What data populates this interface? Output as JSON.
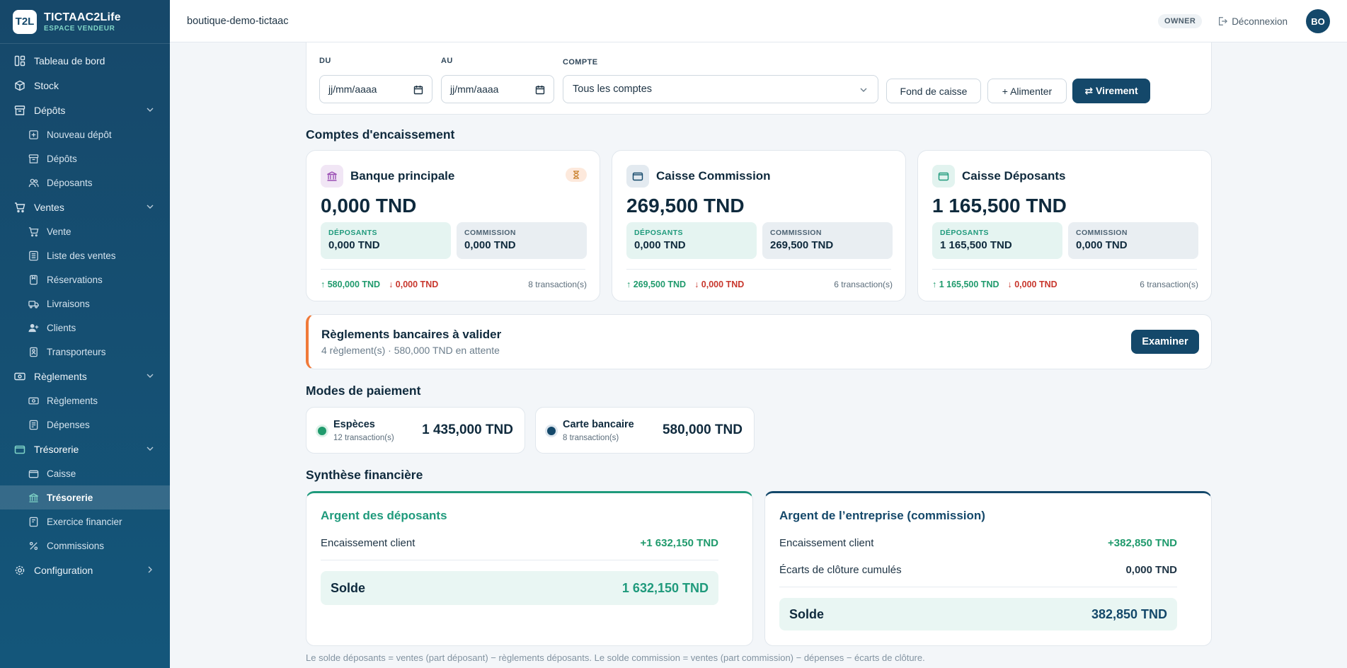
{
  "brand": {
    "logo": "T2L",
    "name": "TICTAAC2Life",
    "subtitle": "ESPACE VENDEUR"
  },
  "sidebar": {
    "items": [
      {
        "label": "Tableau de bord",
        "icon": "dashboard-icon"
      },
      {
        "label": "Stock",
        "icon": "box-icon"
      },
      {
        "label": "Dépôts",
        "icon": "archive-icon",
        "children": [
          "Nouveau dépôt",
          "Dépôts",
          "Déposants"
        ]
      },
      {
        "label": "Ventes",
        "icon": "cart-icon",
        "children": [
          "Vente",
          "Liste des ventes",
          "Réservations",
          "Livraisons",
          "Clients",
          "Transporteurs"
        ]
      },
      {
        "label": "Règlements",
        "icon": "banknote-icon",
        "children": [
          "Règlements",
          "Dépenses"
        ]
      },
      {
        "label": "Trésorerie",
        "icon": "wallet-icon",
        "children": [
          "Caisse",
          "Trésorerie",
          "Exercice financier",
          "Commissions"
        ],
        "active_child": "Trésorerie"
      },
      {
        "label": "Configuration",
        "icon": "gear-icon"
      }
    ]
  },
  "header": {
    "shop": "boutique-demo-tictaac",
    "role": "OWNER",
    "logout": "Déconnexion",
    "avatar": "BO"
  },
  "filters": {
    "from_label": "DU",
    "from_value": "jj/mm/aaaa",
    "to_label": "AU",
    "to_value": "jj/mm/aaaa",
    "account_label": "COMPTE",
    "account_value": "Tous les comptes",
    "btn_fund": "Fond de caisse",
    "btn_feed": "+ Alimenter",
    "btn_transfer": "⇄ Virement"
  },
  "accounts_title": "Comptes d'encaissement",
  "accounts": [
    {
      "name": "Banque principale",
      "balance": "0,000 TND",
      "dep_label": "DÉPOSANTS",
      "dep": "0,000 TND",
      "com_label": "COMMISSION",
      "com": "0,000 TND",
      "in": "↑ 580,000 TND",
      "out": "↓ 0,000 TND",
      "tx": "8 transaction(s)",
      "pending": true
    },
    {
      "name": "Caisse Commission",
      "balance": "269,500 TND",
      "dep_label": "DÉPOSANTS",
      "dep": "0,000 TND",
      "com_label": "COMMISSION",
      "com": "269,500 TND",
      "in": "↑ 269,500 TND",
      "out": "↓ 0,000 TND",
      "tx": "6 transaction(s)",
      "pending": false
    },
    {
      "name": "Caisse Déposants",
      "balance": "1 165,500 TND",
      "dep_label": "DÉPOSANTS",
      "dep": "1 165,500 TND",
      "com_label": "COMMISSION",
      "com": "0,000 TND",
      "in": "↑ 1 165,500 TND",
      "out": "↓ 0,000 TND",
      "tx": "6 transaction(s)",
      "pending": false
    }
  ],
  "alert": {
    "title": "Règlements bancaires à valider",
    "subtitle": "4 règlement(s) · 580,000 TND en attente",
    "button": "Examiner"
  },
  "payments_title": "Modes de paiement",
  "payments": [
    {
      "name": "Espèces",
      "tx": "12 transaction(s)",
      "value": "1 435,000 TND",
      "color": "#1f9a6c"
    },
    {
      "name": "Carte bancaire",
      "tx": "8 transaction(s)",
      "value": "580,000 TND",
      "color": "#14486a"
    }
  ],
  "synthesis_title": "Synthèse financière",
  "synthesis": {
    "depositors": {
      "title": "Argent des déposants",
      "row1_label": "Encaissement client",
      "row1_value": "+1 632,150 TND",
      "solde_label": "Solde",
      "solde_value": "1 632,150 TND"
    },
    "company": {
      "title": "Argent de l’entreprise (commission)",
      "row1_label": "Encaissement client",
      "row1_value": "+382,850 TND",
      "row2_label": "Écarts de clôture cumulés",
      "row2_value": "0,000 TND",
      "solde_label": "Solde",
      "solde_value": "382,850 TND"
    }
  },
  "footnote": "Le solde déposants = ventes (part déposant) − règlements déposants. Le solde commission = ventes (part commission) − dépenses − écarts de clôture.",
  "colors": {
    "primary": "#14486a",
    "accent": "#1f9a7c",
    "alert": "#f07a3a"
  }
}
